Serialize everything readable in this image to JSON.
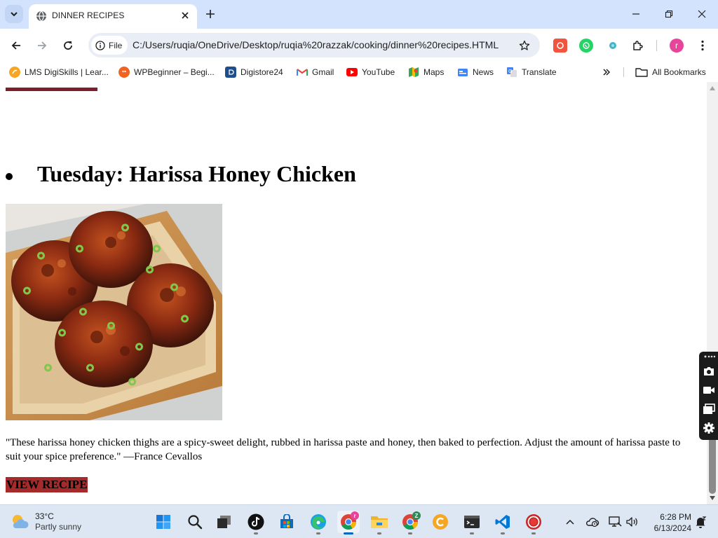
{
  "browser": {
    "tab": {
      "title": "DINNER RECIPES"
    },
    "address": {
      "chip_label": "File",
      "url": "C:/Users/ruqia/OneDrive/Desktop/ruqia%20razzak/cooking/dinner%20recipes.HTML"
    },
    "profile_initial": "r",
    "bookmarks": [
      {
        "label": "LMS DigiSkills | Lear...",
        "icon": "digiskills-icon",
        "color": "#f6a623"
      },
      {
        "label": "WPBeginner – Begi...",
        "icon": "wpbeginner-icon",
        "color": "#f26322"
      },
      {
        "label": "Digistore24",
        "icon": "digistore-icon",
        "color": "#1f4e8c"
      },
      {
        "label": "Gmail",
        "icon": "gmail-icon",
        "color": "#ea4335"
      },
      {
        "label": "YouTube",
        "icon": "youtube-icon",
        "color": "#ff0000"
      },
      {
        "label": "Maps",
        "icon": "maps-icon",
        "color": "#34a853"
      },
      {
        "label": "News",
        "icon": "news-icon",
        "color": "#4285f4"
      },
      {
        "label": "Translate",
        "icon": "translate-icon",
        "color": "#4285f4"
      }
    ],
    "all_bookmarks_label": "All Bookmarks"
  },
  "page": {
    "heading": "Tuesday: Harissa Honey Chicken",
    "quote": "\"These harissa honey chicken thighs are a spicy-sweet delight, rubbed in harissa paste and honey, then baked to perfection. Adjust the amount of harissa paste to suit your spice preference.\" —France Cevallos",
    "button_label": "VIEW RECIPE",
    "button_color": "#a52a2a"
  },
  "taskbar": {
    "weather": {
      "temp": "33°C",
      "condition": "Partly sunny"
    },
    "badges": {
      "chrome": "r",
      "chrome2": "Z"
    },
    "clock": {
      "time": "6:28 PM",
      "date": "6/13/2024"
    }
  }
}
